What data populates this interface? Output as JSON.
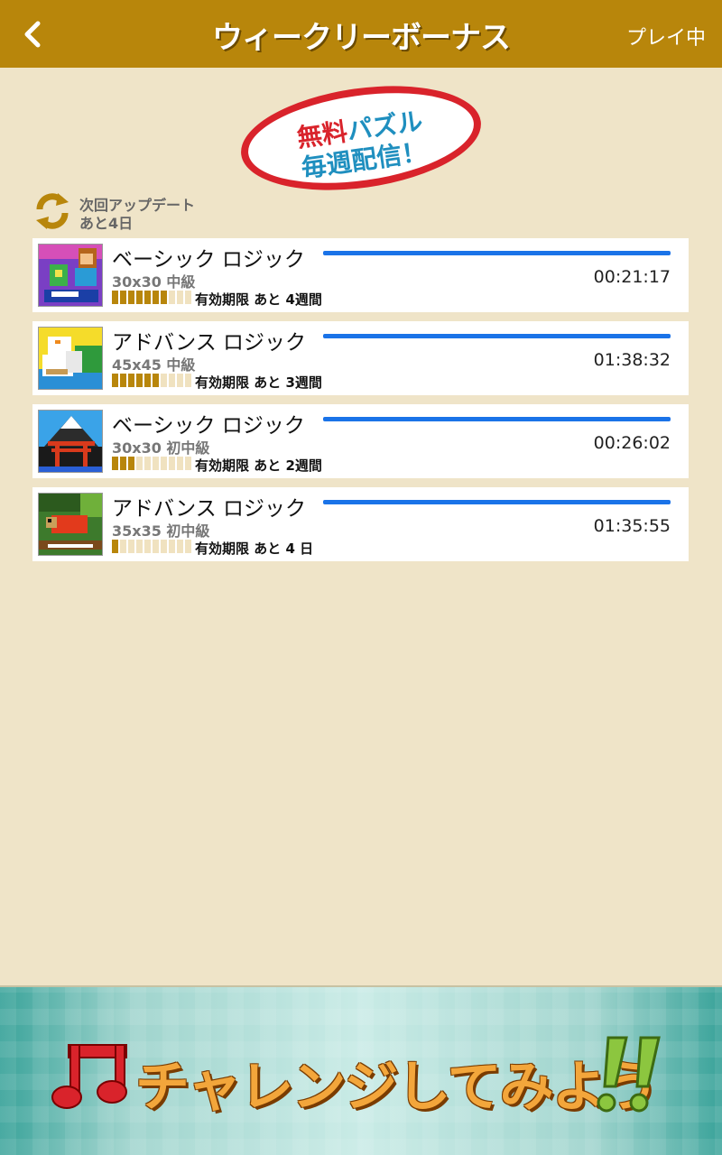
{
  "header": {
    "title": "ウィークリーボーナス",
    "action_label": "プレイ中"
  },
  "badge": {
    "line1_red": "無料",
    "line1_blue": "パズル",
    "line2": "毎週配信！"
  },
  "update": {
    "line1": "次回アップデート",
    "line2": "あと4日"
  },
  "puzzles": [
    {
      "name": "ベーシック ロジック",
      "size_label": "30x30 中級",
      "time": "00:21:17",
      "expiry": "有効期限 あと 4週間",
      "level": 7,
      "thumb": "girl-flowers-thumbnail"
    },
    {
      "name": "アドバンス ロジック",
      "size_label": "45x45 中級",
      "time": "01:38:32",
      "expiry": "有効期限 あと 3週間",
      "level": 6,
      "thumb": "swans-thumbnail"
    },
    {
      "name": "ベーシック ロジック",
      "size_label": "30x30 初中級",
      "time": "00:26:02",
      "expiry": "有効期限 あと 2週間",
      "level": 3,
      "thumb": "fuji-torii-thumbnail"
    },
    {
      "name": "アドバンス ロジック",
      "size_label": "35x35 初中級",
      "time": "01:35:55",
      "expiry": "有効期限 あと 4 日",
      "level": 1,
      "thumb": "chameleon-thumbnail"
    }
  ],
  "level_max": 10,
  "banner": {
    "text": "チャレンジしてみよう"
  },
  "colors": {
    "header": "#b8860b",
    "background": "#efe4c8",
    "progress": "#1a73e8",
    "badge_red": "#d9232b",
    "badge_blue": "#1f8fbf"
  }
}
